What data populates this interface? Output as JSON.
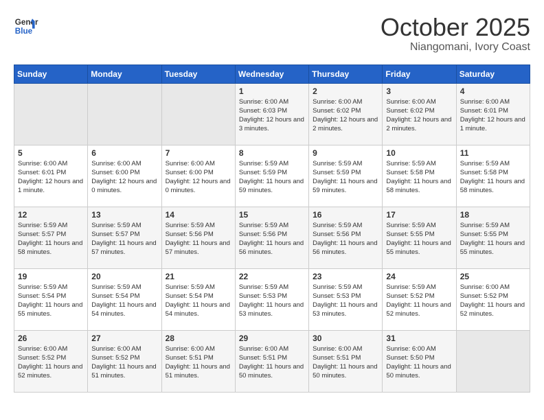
{
  "header": {
    "logo_line1": "General",
    "logo_line2": "Blue",
    "title": "October 2025",
    "subtitle": "Niangomani, Ivory Coast"
  },
  "days_of_week": [
    "Sunday",
    "Monday",
    "Tuesday",
    "Wednesday",
    "Thursday",
    "Friday",
    "Saturday"
  ],
  "weeks": [
    [
      {
        "day": "",
        "info": ""
      },
      {
        "day": "",
        "info": ""
      },
      {
        "day": "",
        "info": ""
      },
      {
        "day": "1",
        "info": "Sunrise: 6:00 AM\nSunset: 6:03 PM\nDaylight: 12 hours and 3 minutes."
      },
      {
        "day": "2",
        "info": "Sunrise: 6:00 AM\nSunset: 6:02 PM\nDaylight: 12 hours and 2 minutes."
      },
      {
        "day": "3",
        "info": "Sunrise: 6:00 AM\nSunset: 6:02 PM\nDaylight: 12 hours and 2 minutes."
      },
      {
        "day": "4",
        "info": "Sunrise: 6:00 AM\nSunset: 6:01 PM\nDaylight: 12 hours and 1 minute."
      }
    ],
    [
      {
        "day": "5",
        "info": "Sunrise: 6:00 AM\nSunset: 6:01 PM\nDaylight: 12 hours and 1 minute."
      },
      {
        "day": "6",
        "info": "Sunrise: 6:00 AM\nSunset: 6:00 PM\nDaylight: 12 hours and 0 minutes."
      },
      {
        "day": "7",
        "info": "Sunrise: 6:00 AM\nSunset: 6:00 PM\nDaylight: 12 hours and 0 minutes."
      },
      {
        "day": "8",
        "info": "Sunrise: 5:59 AM\nSunset: 5:59 PM\nDaylight: 11 hours and 59 minutes."
      },
      {
        "day": "9",
        "info": "Sunrise: 5:59 AM\nSunset: 5:59 PM\nDaylight: 11 hours and 59 minutes."
      },
      {
        "day": "10",
        "info": "Sunrise: 5:59 AM\nSunset: 5:58 PM\nDaylight: 11 hours and 58 minutes."
      },
      {
        "day": "11",
        "info": "Sunrise: 5:59 AM\nSunset: 5:58 PM\nDaylight: 11 hours and 58 minutes."
      }
    ],
    [
      {
        "day": "12",
        "info": "Sunrise: 5:59 AM\nSunset: 5:57 PM\nDaylight: 11 hours and 58 minutes."
      },
      {
        "day": "13",
        "info": "Sunrise: 5:59 AM\nSunset: 5:57 PM\nDaylight: 11 hours and 57 minutes."
      },
      {
        "day": "14",
        "info": "Sunrise: 5:59 AM\nSunset: 5:56 PM\nDaylight: 11 hours and 57 minutes."
      },
      {
        "day": "15",
        "info": "Sunrise: 5:59 AM\nSunset: 5:56 PM\nDaylight: 11 hours and 56 minutes."
      },
      {
        "day": "16",
        "info": "Sunrise: 5:59 AM\nSunset: 5:56 PM\nDaylight: 11 hours and 56 minutes."
      },
      {
        "day": "17",
        "info": "Sunrise: 5:59 AM\nSunset: 5:55 PM\nDaylight: 11 hours and 55 minutes."
      },
      {
        "day": "18",
        "info": "Sunrise: 5:59 AM\nSunset: 5:55 PM\nDaylight: 11 hours and 55 minutes."
      }
    ],
    [
      {
        "day": "19",
        "info": "Sunrise: 5:59 AM\nSunset: 5:54 PM\nDaylight: 11 hours and 55 minutes."
      },
      {
        "day": "20",
        "info": "Sunrise: 5:59 AM\nSunset: 5:54 PM\nDaylight: 11 hours and 54 minutes."
      },
      {
        "day": "21",
        "info": "Sunrise: 5:59 AM\nSunset: 5:54 PM\nDaylight: 11 hours and 54 minutes."
      },
      {
        "day": "22",
        "info": "Sunrise: 5:59 AM\nSunset: 5:53 PM\nDaylight: 11 hours and 53 minutes."
      },
      {
        "day": "23",
        "info": "Sunrise: 5:59 AM\nSunset: 5:53 PM\nDaylight: 11 hours and 53 minutes."
      },
      {
        "day": "24",
        "info": "Sunrise: 5:59 AM\nSunset: 5:52 PM\nDaylight: 11 hours and 52 minutes."
      },
      {
        "day": "25",
        "info": "Sunrise: 6:00 AM\nSunset: 5:52 PM\nDaylight: 11 hours and 52 minutes."
      }
    ],
    [
      {
        "day": "26",
        "info": "Sunrise: 6:00 AM\nSunset: 5:52 PM\nDaylight: 11 hours and 52 minutes."
      },
      {
        "day": "27",
        "info": "Sunrise: 6:00 AM\nSunset: 5:52 PM\nDaylight: 11 hours and 51 minutes."
      },
      {
        "day": "28",
        "info": "Sunrise: 6:00 AM\nSunset: 5:51 PM\nDaylight: 11 hours and 51 minutes."
      },
      {
        "day": "29",
        "info": "Sunrise: 6:00 AM\nSunset: 5:51 PM\nDaylight: 11 hours and 50 minutes."
      },
      {
        "day": "30",
        "info": "Sunrise: 6:00 AM\nSunset: 5:51 PM\nDaylight: 11 hours and 50 minutes."
      },
      {
        "day": "31",
        "info": "Sunrise: 6:00 AM\nSunset: 5:50 PM\nDaylight: 11 hours and 50 minutes."
      },
      {
        "day": "",
        "info": ""
      }
    ]
  ]
}
